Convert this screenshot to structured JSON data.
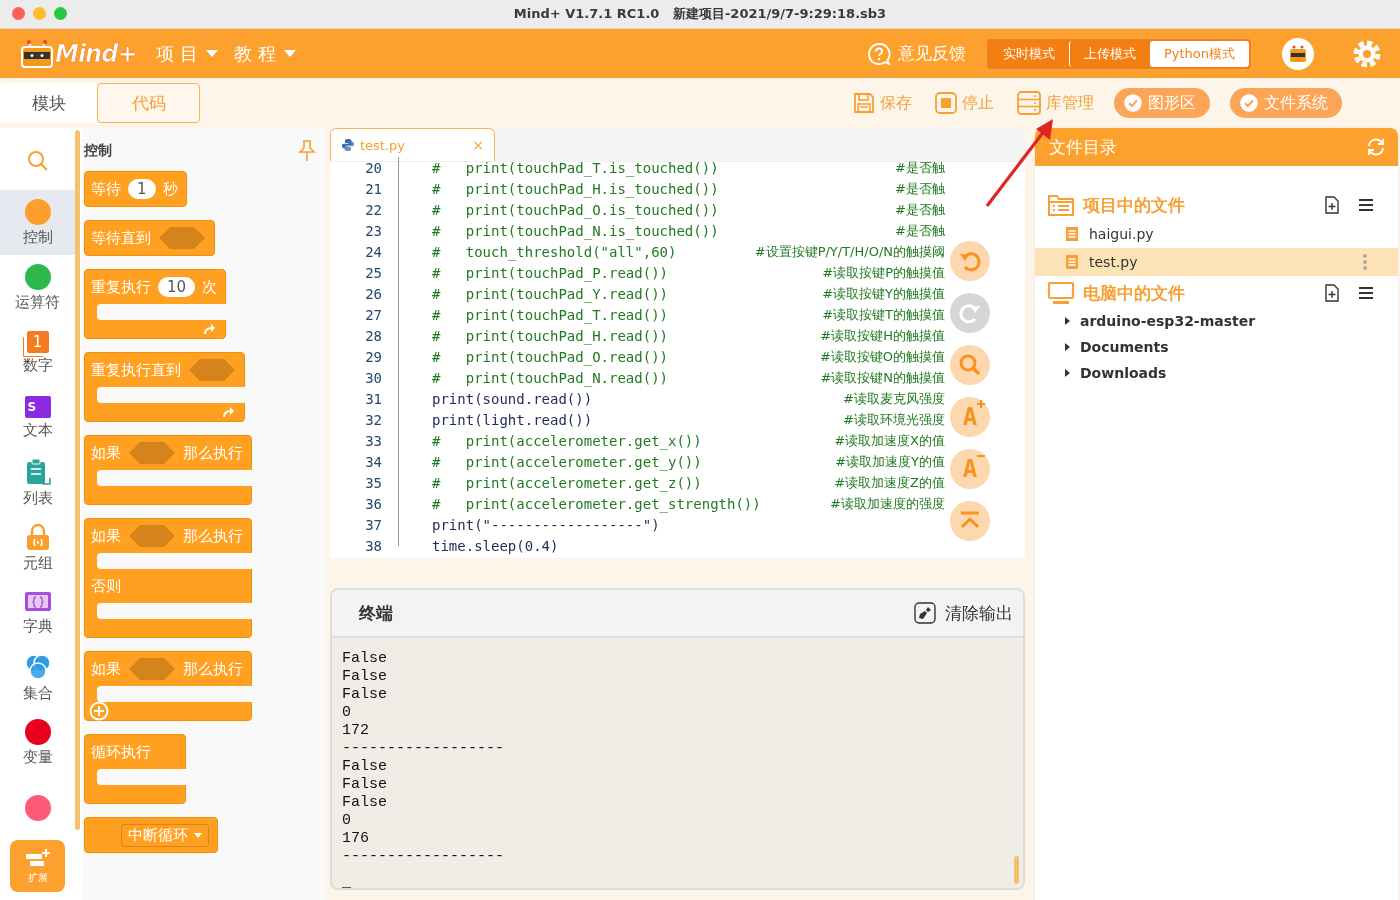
{
  "window": {
    "title": "Mind+ V1.7.1 RC1.0   新建项目-2021/9/7-9:29:18.sb3"
  },
  "header": {
    "logo": "Mind+",
    "menus": [
      {
        "label": "项 目"
      },
      {
        "label": "教 程"
      }
    ],
    "feedback": "意见反馈",
    "modes": [
      {
        "label": "实时模式",
        "selected": false
      },
      {
        "label": "上传模式",
        "selected": false
      },
      {
        "label": "Python模式",
        "selected": true
      }
    ]
  },
  "view_tabs": [
    {
      "label": "模块",
      "selected": false
    },
    {
      "label": "代码",
      "selected": true
    }
  ],
  "actions": [
    {
      "label": "保存",
      "kind": "save"
    },
    {
      "label": "停止",
      "kind": "stop"
    },
    {
      "label": "库管理",
      "kind": "library"
    }
  ],
  "toggles": [
    {
      "label": "图形区",
      "checked": true
    },
    {
      "label": "文件系统",
      "checked": true
    }
  ],
  "categories": [
    {
      "label": "控制",
      "kind": "dot",
      "color": "#fda02b",
      "selected": true
    },
    {
      "label": "运算符",
      "kind": "dot",
      "color": "#2db84b",
      "selected": false
    },
    {
      "label": "数字",
      "kind": "number",
      "color": "#f47c20",
      "icon_text": "1",
      "selected": false
    },
    {
      "label": "文本",
      "kind": "text",
      "color": "#8a2be2",
      "icon_text": "S",
      "selected": false
    },
    {
      "label": "列表",
      "kind": "list",
      "color": "#2aa59a",
      "selected": false
    },
    {
      "label": "元组",
      "kind": "tuple",
      "color": "#f7a02c",
      "selected": false
    },
    {
      "label": "字典",
      "kind": "dict",
      "color": "#a64fd8",
      "selected": false
    },
    {
      "label": "集合",
      "kind": "set",
      "color": "#2e9be6",
      "selected": false
    },
    {
      "label": "变量",
      "kind": "dot",
      "color": "#e8001c",
      "selected": false
    },
    {
      "kind": "dot",
      "color": "#ff5a78",
      "selected": false
    }
  ],
  "extension_button": "扩展",
  "palette": {
    "title": "控制",
    "blocks": [
      {
        "kind": "command",
        "parts": [
          {
            "kind": "text",
            "text": "等待"
          },
          {
            "kind": "number",
            "text": "1"
          },
          {
            "kind": "text",
            "text": "秒"
          }
        ]
      },
      {
        "kind": "command",
        "parts": [
          {
            "kind": "text",
            "text": "等待直到"
          },
          {
            "kind": "bool"
          }
        ]
      },
      {
        "kind": "loop",
        "parts": [
          {
            "kind": "text",
            "text": "重复执行"
          },
          {
            "kind": "number",
            "text": "10"
          },
          {
            "kind": "text",
            "text": "次"
          }
        ]
      },
      {
        "kind": "loop",
        "parts": [
          {
            "kind": "text",
            "text": "重复执行直到"
          },
          {
            "kind": "bool"
          }
        ]
      },
      {
        "kind": "if",
        "parts": [
          {
            "kind": "text",
            "text": "如果"
          },
          {
            "kind": "bool"
          },
          {
            "kind": "text",
            "text": "那么执行"
          }
        ]
      },
      {
        "kind": "if-else",
        "else_label": "否则",
        "parts": [
          {
            "kind": "text",
            "text": "如果"
          },
          {
            "kind": "bool"
          },
          {
            "kind": "text",
            "text": "那么执行"
          }
        ]
      },
      {
        "kind": "if-plus",
        "parts": [
          {
            "kind": "text",
            "text": "如果"
          },
          {
            "kind": "bool"
          },
          {
            "kind": "text",
            "text": "那么执行"
          }
        ]
      },
      {
        "kind": "forever",
        "parts": [
          {
            "kind": "text",
            "text": "循环执行"
          }
        ]
      },
      {
        "kind": "command",
        "parts": [
          {
            "kind": "dropdown",
            "text": "中断循环"
          }
        ]
      }
    ]
  },
  "editor": {
    "tab": "test.py",
    "close": "×",
    "lines": [
      {
        "number": "20",
        "kind": "commented",
        "code": "#   print(touchPad_T.is_touched())",
        "comment": "#是否触"
      },
      {
        "number": "21",
        "kind": "commented",
        "code": "#   print(touchPad_H.is_touched())",
        "comment": "#是否触"
      },
      {
        "number": "22",
        "kind": "commented",
        "code": "#   print(touchPad_O.is_touched())",
        "comment": "#是否触"
      },
      {
        "number": "23",
        "kind": "commented",
        "code": "#   print(touchPad_N.is_touched())",
        "comment": "#是否触"
      },
      {
        "number": "24",
        "kind": "commented",
        "code": "#   touch_threshold(\"all\",60)",
        "comment": "#设置按键P/Y/T/H/O/N的触摸阈"
      },
      {
        "number": "25",
        "kind": "commented",
        "code": "#   print(touchPad_P.read())",
        "comment": "#读取按键P的触摸值"
      },
      {
        "number": "26",
        "kind": "commented",
        "code": "#   print(touchPad_Y.read())",
        "comment": "#读取按键Y的触摸值"
      },
      {
        "number": "27",
        "kind": "commented",
        "code": "#   print(touchPad_T.read())",
        "comment": "#读取按键T的触摸值"
      },
      {
        "number": "28",
        "kind": "commented",
        "code": "#   print(touchPad_H.read())",
        "comment": "#读取按键H的触摸值"
      },
      {
        "number": "29",
        "kind": "commented",
        "code": "#   print(touchPad_O.read())",
        "comment": "#读取按键O的触摸值"
      },
      {
        "number": "30",
        "kind": "commented",
        "code": "#   print(touchPad_N.read())",
        "comment": "#读取按键N的触摸值"
      },
      {
        "number": "31",
        "kind": "code",
        "code": "print(sound.read())",
        "comment": "#读取麦克风强度"
      },
      {
        "number": "32",
        "kind": "code",
        "code": "print(light.read())",
        "comment": "#读取环境光强度"
      },
      {
        "number": "33",
        "kind": "commented",
        "code": "#   print(accelerometer.get_x())",
        "comment": "#读取加速度X的值"
      },
      {
        "number": "34",
        "kind": "commented",
        "code": "#   print(accelerometer.get_y())",
        "comment": "#读取加速度Y的值"
      },
      {
        "number": "35",
        "kind": "commented",
        "code": "#   print(accelerometer.get_z())",
        "comment": "#读取加速度Z的值"
      },
      {
        "number": "36",
        "kind": "commented",
        "code": "#   print(accelerometer.get_strength())",
        "comment": "#读取加速度的强度"
      },
      {
        "number": "37",
        "kind": "code",
        "code": "print(\"------------------\")"
      },
      {
        "number": "38",
        "kind": "code",
        "code": "time.sleep(0.4)"
      }
    ],
    "float_buttons": [
      {
        "kind": "undo",
        "disabled": false
      },
      {
        "kind": "redo",
        "disabled": true
      },
      {
        "kind": "search",
        "disabled": false
      },
      {
        "kind": "zoom-in",
        "glyph": "A",
        "disabled": false
      },
      {
        "kind": "zoom-out",
        "glyph": "A",
        "disabled": false
      },
      {
        "kind": "top",
        "disabled": false
      }
    ]
  },
  "terminal": {
    "title": "终端",
    "clear": "清除输出",
    "output": [
      "False",
      "False",
      "False",
      "0",
      "172",
      "------------------",
      "False",
      "False",
      "False",
      "0",
      "176",
      "------------------"
    ],
    "cursor": "_"
  },
  "files": {
    "title": "文件目录",
    "sections": [
      {
        "title": "项目中的文件",
        "kind": "project",
        "items": [
          {
            "name": "haigui.py",
            "kind": "file",
            "selected": false
          },
          {
            "name": "test.py",
            "kind": "file",
            "selected": true
          }
        ]
      },
      {
        "title": "电脑中的文件",
        "kind": "computer",
        "items": [
          {
            "name": "arduino-esp32-master",
            "kind": "folder",
            "selected": false
          },
          {
            "name": "Documents",
            "kind": "folder",
            "selected": false
          },
          {
            "name": "Downloads",
            "kind": "folder",
            "selected": false
          }
        ]
      }
    ]
  }
}
